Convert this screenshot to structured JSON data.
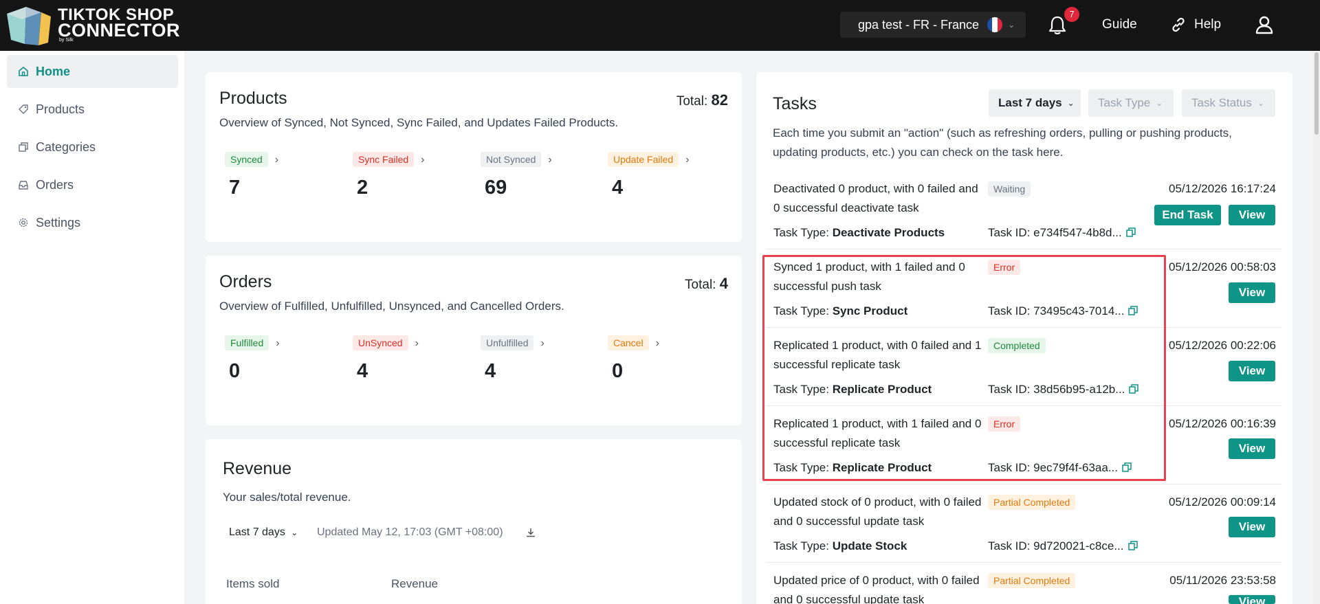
{
  "header": {
    "logo_line1": "TIKTOK SHOP",
    "logo_line2": "CONNECTOR",
    "logo_by": "by Silk",
    "store_name": "gpa test - FR  -  France",
    "notifications_count": "7",
    "guide_label": "Guide",
    "help_label": "Help"
  },
  "sidebar": {
    "items": [
      {
        "label": "Home",
        "icon": "home-icon",
        "active": true
      },
      {
        "label": "Products",
        "icon": "tag-icon"
      },
      {
        "label": "Categories",
        "icon": "copy-icon"
      },
      {
        "label": "Orders",
        "icon": "inbox-icon"
      },
      {
        "label": "Settings",
        "icon": "gear-icon"
      }
    ]
  },
  "products": {
    "title": "Products",
    "total_label": "Total: ",
    "total": "82",
    "description": "Overview of Synced, Not Synced, Sync Failed, and Updates Failed Products.",
    "stats": [
      {
        "label": "Synced",
        "value": "7",
        "color": "green"
      },
      {
        "label": "Sync Failed",
        "value": "2",
        "color": "red"
      },
      {
        "label": "Not Synced",
        "value": "69",
        "color": "gray"
      },
      {
        "label": "Update Failed",
        "value": "4",
        "color": "orange"
      }
    ]
  },
  "orders": {
    "title": "Orders",
    "total_label": "Total: ",
    "total": "4",
    "description": "Overview of Fulfilled, Unfulfilled, Unsynced, and Cancelled Orders.",
    "stats": [
      {
        "label": "Fulfilled",
        "value": "0",
        "color": "green"
      },
      {
        "label": "UnSynced",
        "value": "4",
        "color": "red"
      },
      {
        "label": "Unfulfilled",
        "value": "4",
        "color": "gray"
      },
      {
        "label": "Cancel",
        "value": "0",
        "color": "orange"
      }
    ]
  },
  "revenue": {
    "title": "Revenue",
    "description": "Your sales/total revenue.",
    "range": "Last 7 days",
    "updated": "Updated May 12, 17:03 (GMT +08:00)",
    "columns": [
      "Items sold",
      "Revenue"
    ]
  },
  "tasks": {
    "title": "Tasks",
    "filters": {
      "range": "Last 7 days",
      "type": "Task Type",
      "status": "Task Status"
    },
    "description": "Each time you submit an \"action\" (such as refreshing orders, pulling or pushing products, updating products, etc.) you can check on the task here.",
    "type_label": "Task Type: ",
    "end_task_label": "End Task",
    "view_label": "View",
    "items": [
      {
        "title": "Deactivated 0 product, with 0 failed and 0 successful deactivate task",
        "status": "Waiting",
        "date": "05/12/2026 16:17:24",
        "type": "Deactivate Products",
        "id": "Task ID: e734f547-4b8d..."
      },
      {
        "title": "Synced 1 product, with 1 failed and 0 successful push task",
        "status": "Error",
        "date": "05/12/2026 00:58:03",
        "type": "Sync Product",
        "id": "Task ID: 73495c43-7014..."
      },
      {
        "title": "Replicated 1 product, with 0 failed and 1 successful replicate task",
        "status": "Completed",
        "date": "05/12/2026 00:22:06",
        "type": "Replicate Product",
        "id": "Task ID: 38d56b95-a12b..."
      },
      {
        "title": "Replicated 1 product, with 1 failed and 0 successful replicate task",
        "status": "Error",
        "date": "05/12/2026 00:16:39",
        "type": "Replicate Product",
        "id": "Task ID: 9ec79f4f-63aa..."
      },
      {
        "title": "Updated stock of 0 product, with 0 failed and 0 successful update task",
        "status": "Partial Completed",
        "date": "05/12/2026 00:09:14",
        "type": "Update Stock",
        "id": "Task ID: 9d720021-c8ce..."
      },
      {
        "title": "Updated price of 0 product, with 0 failed and 0 successful update task",
        "status": "Partial Completed",
        "date": "05/11/2026 23:53:58"
      }
    ]
  }
}
